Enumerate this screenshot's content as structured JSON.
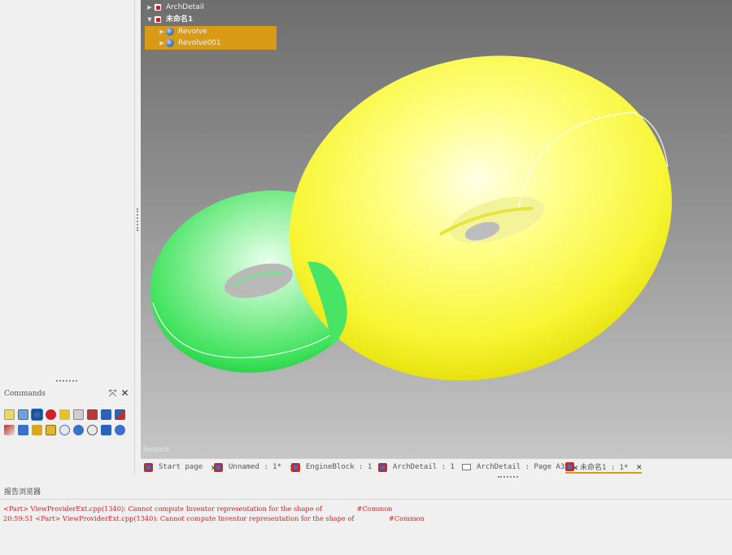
{
  "tree": {
    "items": [
      {
        "label": "ArchDetail",
        "expanded": false
      },
      {
        "label": "未命名1",
        "expanded": true
      },
      {
        "label": "Revolve",
        "selected": true
      },
      {
        "label": "Revolve001",
        "selected": true
      }
    ]
  },
  "viewport": {
    "search_label": "Search"
  },
  "commands": {
    "title": "Commands"
  },
  "tabs": [
    {
      "label": "Start page"
    },
    {
      "label": "Unnamed : 1*"
    },
    {
      "label": "EngineBlock : 1"
    },
    {
      "label": "ArchDetail : 1"
    },
    {
      "label": "ArchDetail : Page A3"
    },
    {
      "label": "未命名1 : 1*",
      "active": true
    }
  ],
  "report": {
    "title": "报告浏览器",
    "lines": [
      {
        "prefix": "<Part> ViewProviderExt.cpp(1340): Cannot compute Inventor representation for the shape of",
        "suffix": "#Common"
      },
      {
        "prefix": "20:59:51  <Part> ViewProviderExt.cpp(1340): Cannot compute Inventor representation for the shape of",
        "suffix": "#Common"
      }
    ]
  },
  "colors": {
    "selection": "#d99b16",
    "error_text": "#e21b1b",
    "torus_large": "#f5f53a",
    "torus_small": "#35e05a"
  }
}
